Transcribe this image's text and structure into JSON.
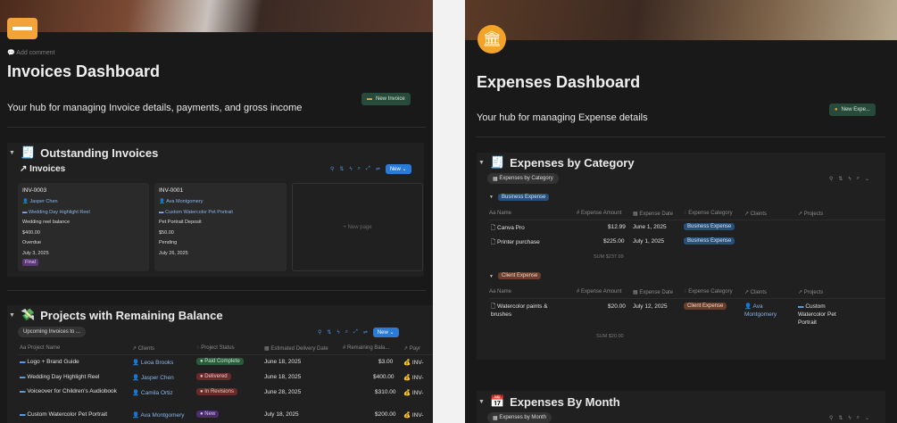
{
  "left": {
    "add_comment": "Add comment",
    "title": "Invoices Dashboard",
    "subtitle": "Your hub for managing Invoice details, payments, and gross income",
    "new_button": "New Invoice",
    "outstanding": {
      "title": "Outstanding Invoices",
      "db_title": "Invoices",
      "new_label": "New",
      "new_page": "+ New page",
      "cards": [
        {
          "id": "INV-0003",
          "client": "Jasper Chen",
          "project": "Wedding Day Highlight Reel",
          "desc": "Wedding reel balance",
          "amount": "$400.00",
          "status": "Overdue",
          "date": "July 3, 2025",
          "tag": "Final"
        },
        {
          "id": "INV-0001",
          "client": "Ava Montgomery",
          "project": "Custom Watercolor Pet Portrait",
          "desc": "Pet Portrait Deposit",
          "amount": "$50.00",
          "status": "Pending",
          "date": "July 26, 2025",
          "tag": ""
        }
      ]
    },
    "projects": {
      "title": "Projects with Remaining Balance",
      "view": "Upcoming Invoices to ...",
      "new_label": "New",
      "columns": [
        "Aa Project Name",
        "Clients",
        "Project Status",
        "Estimated Delivery Date",
        "Remaining Bala...",
        "Payr"
      ],
      "rows": [
        {
          "name": "Logo + Brand Guide",
          "client": "Leoa Brooks",
          "status": "Paid Complete",
          "status_color": "green",
          "date": "June 18, 2025",
          "remaining": "$3.00",
          "pay": "INV-"
        },
        {
          "name": "Wedding Day Highlight Reel",
          "client": "Jasper Chen",
          "status": "Delivered",
          "status_color": "red",
          "date": "June 18, 2025",
          "remaining": "$400.00",
          "pay": "INV-"
        },
        {
          "name": "Voiceover for Children's Audiobook",
          "client": "Camila Ortiz",
          "status": "In Revisions",
          "status_color": "red",
          "date": "June 28, 2025",
          "remaining": "$310.00",
          "pay": "INV-"
        },
        {
          "name": "Custom Watercolor Pet Portrait",
          "client": "Ava Montgomery",
          "status": "New",
          "status_color": "purple",
          "date": "July 18, 2025",
          "remaining": "$200.00",
          "pay": "INV-"
        }
      ]
    }
  },
  "right": {
    "title": "Expenses Dashboard",
    "subtitle": "Your hub for managing Expense details",
    "new_button": "New Expe...",
    "by_category": {
      "title": "Expenses by Category",
      "view": "Expenses by Category",
      "columns": [
        "Aa Name",
        "# Expense Amount",
        "Expense Date",
        "Expense Category",
        "Clients",
        "Projects"
      ],
      "groups": [
        {
          "label": "Business Expense",
          "color": "blue",
          "rows": [
            {
              "name": "Canva Pro",
              "amount": "$12.99",
              "date": "June 1, 2025",
              "category": "Business Expense",
              "client": "",
              "project": ""
            },
            {
              "name": "Printer purchase",
              "amount": "$225.00",
              "date": "July 1, 2025",
              "category": "Business Expense",
              "client": "",
              "project": ""
            }
          ],
          "sum": "SUM $237.99"
        },
        {
          "label": "Client Expense",
          "color": "brown",
          "rows": [
            {
              "name": "Watercolor paints & brushes",
              "amount": "$20.00",
              "date": "July 12, 2025",
              "category": "Client Expense",
              "client": "Ava Montgomery",
              "project": "Custom Watercolor Pet Portrait"
            }
          ],
          "sum": "SUM $20.00"
        }
      ]
    },
    "by_month": {
      "title": "Expenses By Month",
      "view": "Expenses by Month"
    }
  }
}
